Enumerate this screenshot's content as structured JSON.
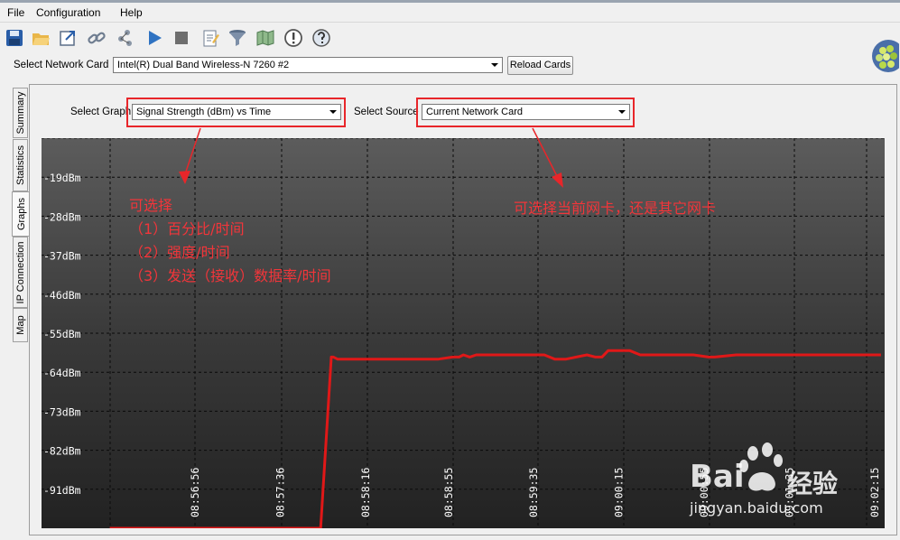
{
  "menu": [
    "File",
    "Configuration",
    "Help"
  ],
  "toolbar_icons": [
    "save-icon",
    "open-folder-icon",
    "export-icon",
    "link-icon",
    "network-map-icon",
    "play-icon",
    "stop-icon",
    "notes-icon",
    "filter-icon",
    "map-icon",
    "alert-icon",
    "help-globe-icon"
  ],
  "network_card": {
    "label": "Select Network Card",
    "selected": "Intel(R) Dual Band Wireless-N 7260 #2",
    "reload_label": "Reload Cards"
  },
  "side_tabs": [
    "Summary",
    "Statistics",
    "Graphs",
    "IP Connection",
    "Map"
  ],
  "active_tab": "Graphs",
  "graph_select": {
    "label": "Select Graph",
    "selected": "Signal Strength (dBm) vs Time"
  },
  "source_select": {
    "label": "Select Source",
    "selected": "Current Network Card"
  },
  "annotations": {
    "graph_note": [
      "可选择",
      "（1）百分比/时间",
      "（2）强度/时间",
      "（3）发送（接收）数据率/时间"
    ],
    "source_note": "可选择当前网卡，还是其它网卡"
  },
  "colors": {
    "annotation": "#e8262a",
    "series": "#e01818",
    "plot_bg": "#2a2a2a"
  },
  "watermark": {
    "brand": "Bai",
    "brand2": "经验",
    "url": "jingyan.baidu.com"
  },
  "chart_data": {
    "type": "line",
    "title": "",
    "xlabel": "",
    "ylabel": "",
    "y_tick_labels": [
      "-19dBm",
      "-28dBm",
      "-37dBm",
      "-46dBm",
      "-55dBm",
      "-64dBm",
      "-73dBm",
      "-82dBm",
      "-91dBm"
    ],
    "y_ticks": [
      -19,
      -28,
      -37,
      -46,
      -55,
      -64,
      -73,
      -82,
      -91
    ],
    "x_tick_labels": [
      "08:56:56",
      "08:57:36",
      "08:58:16",
      "08:58:55",
      "08:59:35",
      "09:00:15",
      "09:00:55",
      "09:01:35",
      "09:02:15"
    ],
    "grid": true,
    "series": [
      {
        "x": [
          "08:56:16",
          "08:57:55",
          "08:58:00",
          "08:58:01",
          "08:58:03",
          "08:58:10",
          "08:58:50",
          "08:58:57",
          "08:59:00",
          "08:59:02",
          "08:59:05",
          "08:59:08",
          "08:59:12",
          "08:59:18",
          "08:59:40",
          "08:59:45",
          "08:59:50",
          "08:59:55",
          "09:00:00",
          "09:00:04",
          "09:00:07",
          "09:00:10",
          "09:00:20",
          "09:00:25",
          "09:00:50",
          "09:00:57",
          "09:01:00",
          "09:01:10",
          "09:01:30",
          "09:02:00",
          "09:02:18"
        ],
        "y": [
          -100,
          -100,
          -60.5,
          -60.5,
          -61,
          -61,
          -61,
          -60.5,
          -60.5,
          -60,
          -60.5,
          -60,
          -60,
          -60,
          -60,
          -61,
          -61,
          -60.5,
          -60,
          -60.5,
          -60.5,
          -59,
          -59,
          -60,
          -60,
          -60.5,
          -60.5,
          -60,
          -60,
          -60,
          -60
        ]
      }
    ]
  }
}
